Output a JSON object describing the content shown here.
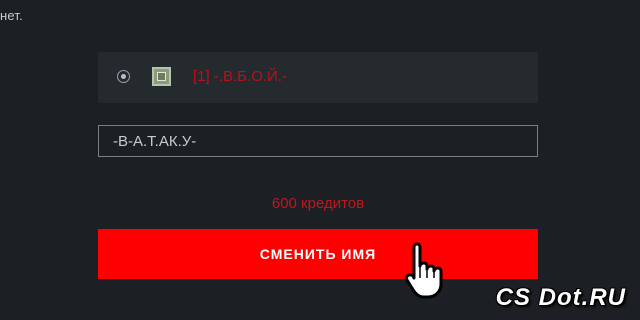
{
  "page": {
    "top_text": "нет."
  },
  "clan_option": {
    "label": "[1] -.В.Б.О.Й.-",
    "selected": true,
    "icon": "clan-tag-icon"
  },
  "name_input": {
    "value": "-В-А.Т.АК.У-"
  },
  "price": {
    "label": "600 кредитов"
  },
  "action": {
    "button_label": "СМЕНИТЬ ИМЯ"
  },
  "watermark": {
    "text": "CS Dot.RU"
  },
  "colors": {
    "background": "#1c1f23",
    "card": "#252a2f",
    "accent_red": "#ff0000",
    "price_red": "#c0161e"
  }
}
